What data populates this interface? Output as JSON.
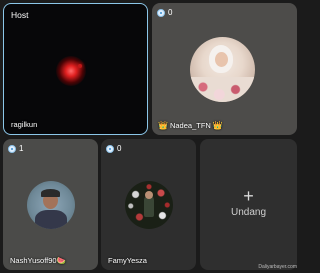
{
  "host_tile": {
    "label": "Host",
    "username": "ragilkun"
  },
  "tiles": [
    {
      "count": "0",
      "username": "Nadea_TFN",
      "crown_left": "👑",
      "crown_right": "👑"
    },
    {
      "count": "1",
      "username": "NashYusoff90🍉"
    },
    {
      "count": "0",
      "username": "FamyYesza"
    }
  ],
  "invite": {
    "plus": "+",
    "label": "Undang"
  },
  "watermark": "Daliyarbayer.com",
  "colors": {
    "host_border": "#8bc6e8",
    "crown": "#f2b52a",
    "badge": "#dfefff"
  }
}
